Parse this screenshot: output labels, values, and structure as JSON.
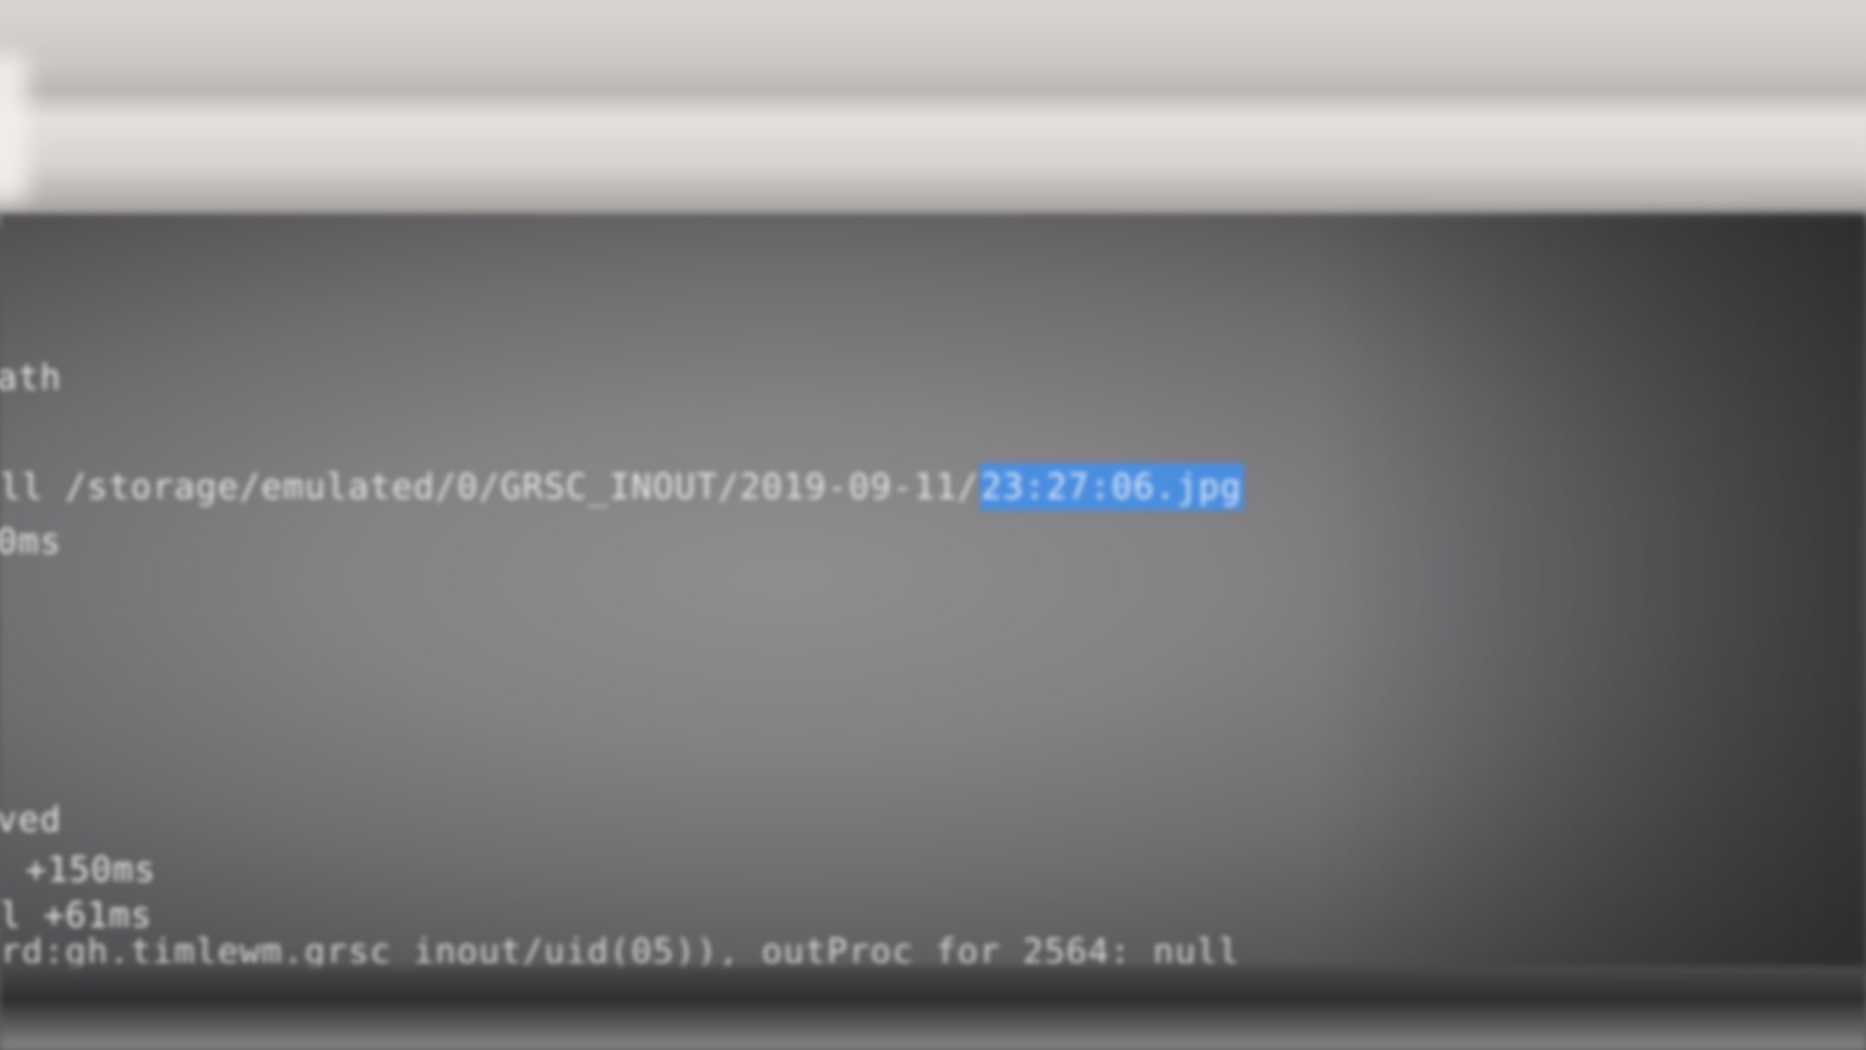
{
  "terminal": {
    "line_1": "ath",
    "line_2_prefix": "ll /storage/emulated/0/GRSC_INOUT/2019-09-11/",
    "line_2_selected": "23:27:06.jpg",
    "line_3": "0ms",
    "line_4": "ved",
    "line_5": "+150ms",
    "line_6": "l +61ms",
    "line_7": "rd:gh.timlewm.grsc_inout/uid(05)), outProc for 2564: null"
  },
  "colors": {
    "selection_bg": "#4a8ee0",
    "terminal_bg": "#828184",
    "terminal_fg": "#e8e6e4"
  }
}
